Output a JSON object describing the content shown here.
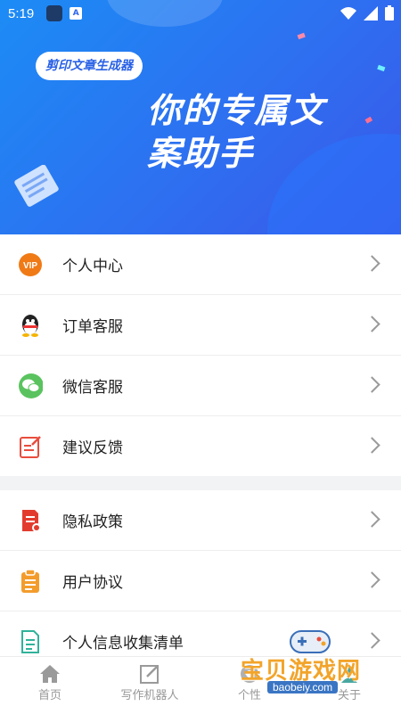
{
  "status_bar": {
    "time": "5:19",
    "app_badge": "A"
  },
  "banner": {
    "tag": "剪印文章生成器",
    "headline_line1": "你的专属文",
    "headline_line2": "案助手"
  },
  "menu_group1": [
    {
      "label": "个人中心",
      "icon": "vip-icon",
      "vip_text": "VIP"
    },
    {
      "label": "订单客服",
      "icon": "qq-icon"
    },
    {
      "label": "微信客服",
      "icon": "wechat-icon"
    },
    {
      "label": "建议反馈",
      "icon": "feedback-icon"
    }
  ],
  "menu_group2": [
    {
      "label": "隐私政策",
      "icon": "privacy-doc-icon"
    },
    {
      "label": "用户协议",
      "icon": "clipboard-icon"
    },
    {
      "label": "个人信息收集清单",
      "icon": "document-icon"
    }
  ],
  "tabbar": [
    {
      "label": "首页",
      "icon": "home-icon"
    },
    {
      "label": "写作机器人",
      "icon": "edit-icon"
    },
    {
      "label": "个性",
      "icon": "personal-icon"
    },
    {
      "label": "关于",
      "icon": "about-icon"
    }
  ],
  "watermark": {
    "text": "宝贝游戏网",
    "url": "baobeiy.com"
  },
  "colors": {
    "brand_blue": "#2f6df0",
    "vip_orange": "#f07a16",
    "wechat_green": "#5ac35f",
    "feedback_red": "#e84d3d"
  }
}
